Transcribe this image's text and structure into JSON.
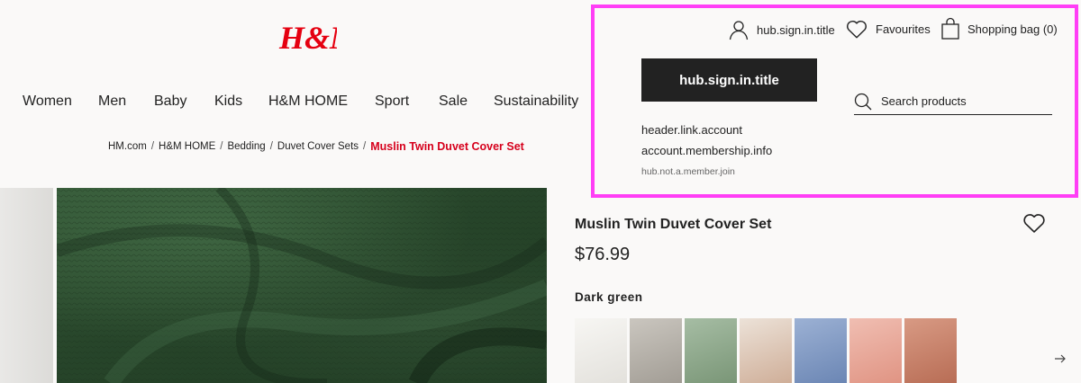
{
  "brand": {
    "logo_text": "H&M",
    "logo_color": "#e50010"
  },
  "nav": [
    {
      "label": "Women"
    },
    {
      "label": "Men"
    },
    {
      "label": "Baby"
    },
    {
      "label": "Kids"
    },
    {
      "label": "H&M HOME"
    },
    {
      "label": "Sport"
    },
    {
      "label": "Sale"
    },
    {
      "label": "Sustainability"
    }
  ],
  "breadcrumb": {
    "items": [
      "HM.com",
      "H&M HOME",
      "Bedding",
      "Duvet Cover Sets"
    ],
    "separator": "/",
    "current": "Muslin Twin Duvet Cover Set",
    "current_color": "#d6001c"
  },
  "header": {
    "sign_in": {
      "label": "hub.sign.in.title",
      "icon": "user-icon"
    },
    "favourites": {
      "label": "Favourites",
      "icon": "heart-icon"
    },
    "bag": {
      "label": "Shopping bag (0)",
      "icon": "shopping-bag-icon"
    }
  },
  "panel": {
    "sign_in_button": "hub.sign.in.title",
    "account_link": "header.link.account",
    "membership_link": "account.membership.info",
    "join_link": "hub.not.a.member.join",
    "search": {
      "placeholder": "Search products",
      "icon": "search-icon"
    },
    "highlight_color": "#ff3ef6"
  },
  "product": {
    "title": "Muslin Twin Duvet Cover Set",
    "price": "$76.99",
    "color_name": "Dark green",
    "wishlist_icon": "heart-icon",
    "swatches": [
      {
        "name": "White",
        "color": "#ecebe8"
      },
      {
        "name": "Light grey",
        "color": "#b7b3ad"
      },
      {
        "name": "Sage green",
        "color": "#8aa588"
      },
      {
        "name": "Beige",
        "color": "#dcc6b4"
      },
      {
        "name": "Blue",
        "color": "#7f98c2"
      },
      {
        "name": "Pink",
        "color": "#e8a79a"
      },
      {
        "name": "Terracotta",
        "color": "#c98068"
      }
    ],
    "next_icon": "arrow-right-icon"
  }
}
